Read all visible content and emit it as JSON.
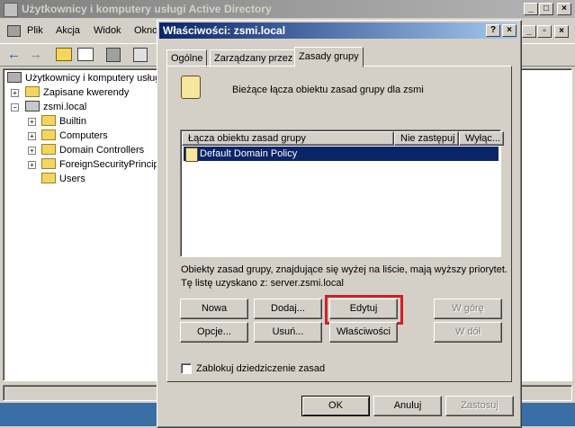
{
  "main_window": {
    "title": "Użytkownicy i komputery usługi Active Directory",
    "menu": [
      "Plik",
      "Akcja",
      "Widok",
      "Okno"
    ],
    "tree": {
      "root": "Użytkownicy i komputery usług",
      "items": [
        {
          "label": "Zapisane kwerendy"
        },
        {
          "label": "zsmi.local"
        },
        {
          "label": "Builtin"
        },
        {
          "label": "Computers"
        },
        {
          "label": "Domain Controllers"
        },
        {
          "label": "ForeignSecurityPrincipa"
        },
        {
          "label": "Users"
        }
      ]
    }
  },
  "dialog": {
    "title": "Właściwości: zsmi.local",
    "help_btn": "?",
    "close_btn": "×",
    "tabs": [
      "Ogólne",
      "Zarządzany przez",
      "Zasady grupy"
    ],
    "active_tab": "Zasady grupy",
    "header_text": "Bieżące łącza obiektu zasad grupy dla zsmi",
    "list": {
      "columns": [
        "Łącza obiektu zasad grupy",
        "Nie zastępuj",
        "Wyłąc..."
      ],
      "rows": [
        {
          "name": "Default Domain Policy",
          "selected": true
        }
      ]
    },
    "info_line1": "Obiekty zasad grupy, znajdujące się wyżej na liście, mają wyższy priorytet.",
    "info_line2": "Tę listę uzyskano z: server.zsmi.local",
    "buttons": {
      "new": "Nowa",
      "add": "Dodaj...",
      "edit": "Edytuj",
      "up": "W górę",
      "options": "Opcje...",
      "delete": "Usuń...",
      "properties": "Właściwości",
      "down": "W dół"
    },
    "checkbox_label": "Zablokuj dziedziczenie zasad",
    "footer": {
      "ok": "OK",
      "cancel": "Anuluj",
      "apply": "Zastosuj"
    },
    "highlight_color": "#d0202a"
  },
  "colors": {
    "titlebar_active": "#0a246a",
    "titlebar_inactive": "#808080",
    "selection": "#0a246a"
  }
}
